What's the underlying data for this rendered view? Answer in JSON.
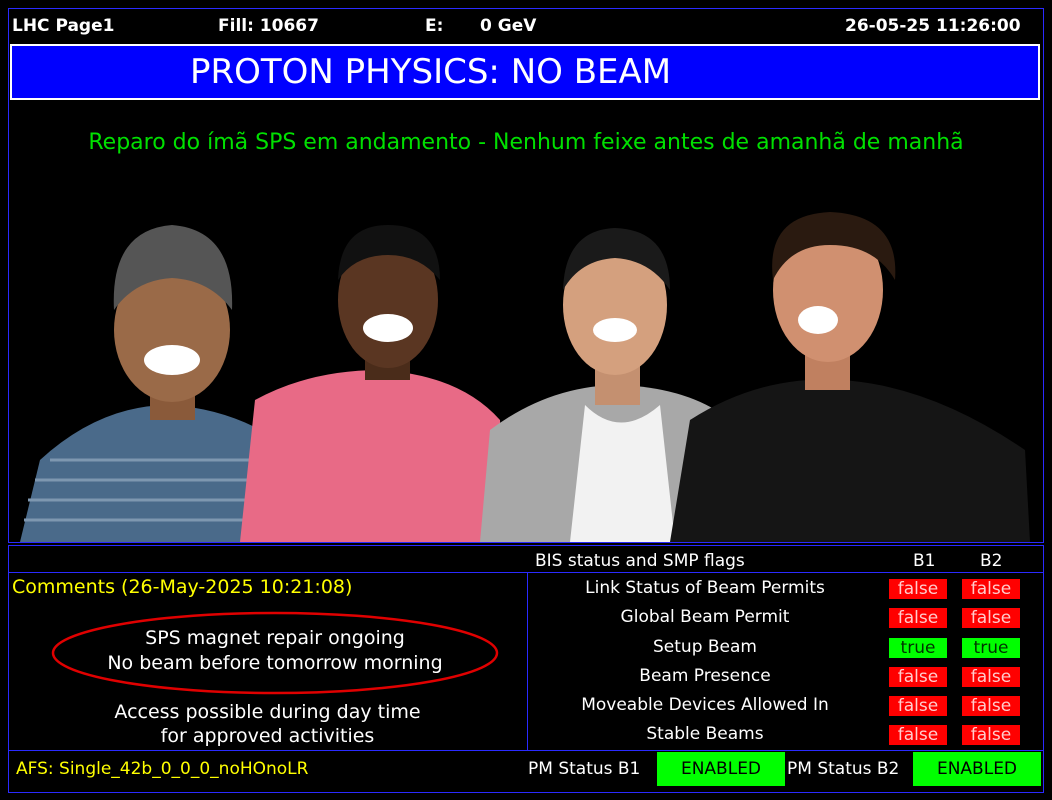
{
  "header": {
    "page": "LHC Page1",
    "fill": "Fill: 10667",
    "energy_label": "E:",
    "energy_value": "0 GeV",
    "datetime": "26-05-25 11:26:00"
  },
  "title": "PROTON PHYSICS: NO BEAM",
  "message": "Reparo do ímã SPS em andamento  - Nenhum feixe antes de amanhã de manhã",
  "comments": {
    "heading": "Comments (26-May-2025 10:21:08)",
    "line1": "SPS magnet repair ongoing",
    "line2": "No beam before tomorrow morning",
    "line3": "Access possible during day time",
    "line4": "for approved activities"
  },
  "bis": {
    "heading": "BIS status and SMP flags",
    "col_b1": "B1",
    "col_b2": "B2",
    "rows": [
      {
        "label": "Link Status of Beam Permits",
        "b1": "false",
        "b2": "false"
      },
      {
        "label": "Global Beam Permit",
        "b1": "false",
        "b2": "false"
      },
      {
        "label": "Setup Beam",
        "b1": "true",
        "b2": "true"
      },
      {
        "label": "Beam Presence",
        "b1": "false",
        "b2": "false"
      },
      {
        "label": "Moveable Devices Allowed In",
        "b1": "false",
        "b2": "false"
      },
      {
        "label": "Stable Beams",
        "b1": "false",
        "b2": "false"
      }
    ]
  },
  "footer": {
    "afs": "AFS: Single_42b_0_0_0_noHOnoLR",
    "pm_b1_label": "PM Status B1",
    "pm_b1_value": "ENABLED",
    "pm_b2_label": "PM Status B2",
    "pm_b2_value": "ENABLED"
  },
  "colors": {
    "title_bg": "#0000ff",
    "message": "#00e000",
    "comments": "#ffff00",
    "false_flag": "#ff0000",
    "true_flag": "#00ff00"
  }
}
